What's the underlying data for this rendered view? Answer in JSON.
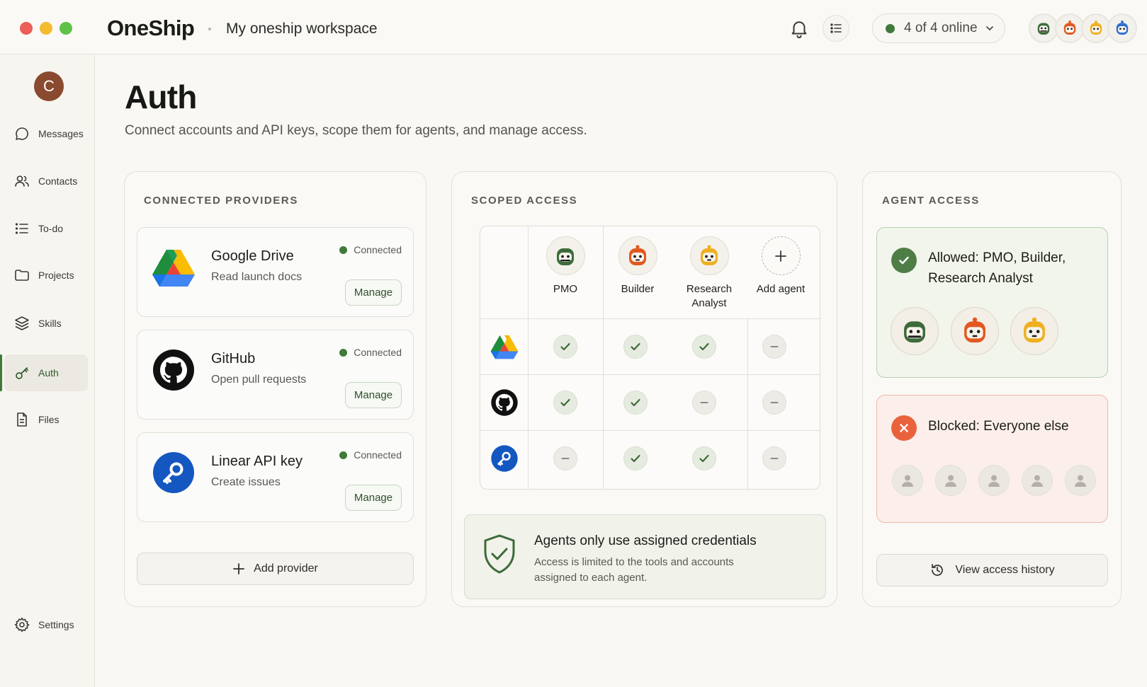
{
  "app": {
    "brand": "OneShip",
    "workspace": "My oneship workspace",
    "online_status": "4 of 4 online"
  },
  "sidebar": {
    "user_initial": "C",
    "items": [
      {
        "label": "Messages",
        "icon": "message-icon"
      },
      {
        "label": "Contacts",
        "icon": "contacts-icon"
      },
      {
        "label": "To-do",
        "icon": "todo-icon"
      },
      {
        "label": "Projects",
        "icon": "folder-icon"
      },
      {
        "label": "Skills",
        "icon": "layers-icon"
      },
      {
        "label": "Auth",
        "icon": "key-icon",
        "active": true
      },
      {
        "label": "Files",
        "icon": "file-icon"
      }
    ],
    "settings_label": "Settings"
  },
  "page": {
    "title": "Auth",
    "subtitle": "Connect accounts and API keys, scope them for agents, and manage access."
  },
  "providers": {
    "heading": "CONNECTED PROVIDERS",
    "items": [
      {
        "name": "Google Drive",
        "description": "Read launch docs",
        "status": "Connected",
        "action": "Manage",
        "icon": "google-drive-icon"
      },
      {
        "name": "GitHub",
        "description": "Open pull requests",
        "status": "Connected",
        "action": "Manage",
        "icon": "github-icon"
      },
      {
        "name": "Linear API key",
        "description": "Create issues",
        "status": "Connected",
        "action": "Manage",
        "icon": "key-icon"
      }
    ],
    "add_label": "Add provider"
  },
  "scoped": {
    "heading": "SCOPED ACCESS",
    "agents": [
      "PMO",
      "Builder",
      "Research Analyst"
    ],
    "add_agent_label": "Add agent",
    "matrix": [
      {
        "provider": "google-drive-icon",
        "access": [
          true,
          true,
          true,
          false
        ]
      },
      {
        "provider": "github-icon",
        "access": [
          true,
          true,
          false,
          false
        ]
      },
      {
        "provider": "key-icon",
        "access": [
          false,
          true,
          true,
          false
        ]
      }
    ],
    "info_title": "Agents only use assigned credentials",
    "info_text": "Access is limited to the tools and accounts assigned to each agent."
  },
  "agent_access": {
    "heading": "AGENT ACCESS",
    "allowed": "Allowed: PMO, Builder, Research Analyst",
    "blocked": "Blocked: Everyone else",
    "history_label": "View access history"
  },
  "colors": {
    "accent_green": "#3f7a3a",
    "blocked_orange": "#e9623c",
    "background": "#f9f8f4",
    "agent_green": "#3d6b3a",
    "agent_orange": "#e2581f",
    "agent_yellow": "#efb01f",
    "agent_blue": "#2f6fd1"
  }
}
